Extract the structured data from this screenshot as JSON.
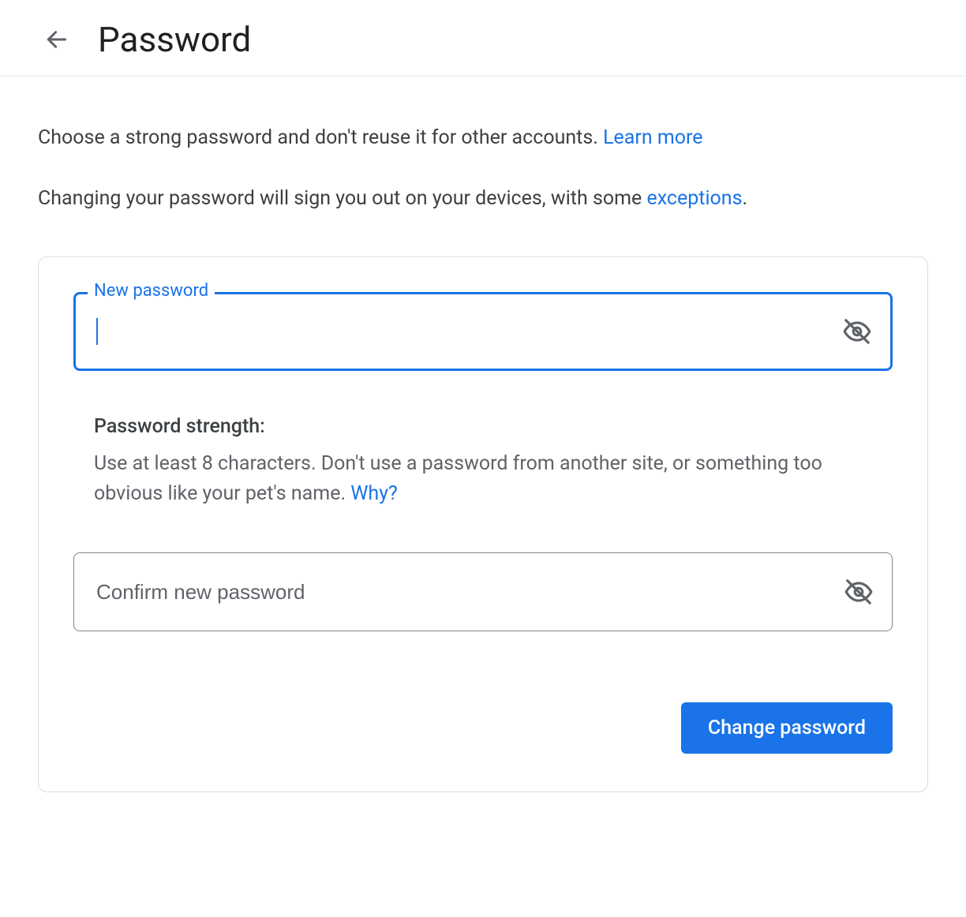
{
  "header": {
    "title": "Password"
  },
  "intro": {
    "line1_text": "Choose a strong password and don't reuse it for other accounts. ",
    "line1_link": "Learn more",
    "line2_text_a": "Changing your password will sign you out on your devices, with some ",
    "line2_link": "exceptions",
    "line2_text_b": "."
  },
  "form": {
    "new_password_label": "New password",
    "new_password_value": "",
    "confirm_placeholder": "Confirm new password",
    "confirm_value": ""
  },
  "strength": {
    "title": "Password strength:",
    "desc_text": "Use at least 8 characters. Don't use a password from another site, or something too obvious like your pet's name. ",
    "why_link": "Why?"
  },
  "actions": {
    "change_label": "Change password"
  }
}
